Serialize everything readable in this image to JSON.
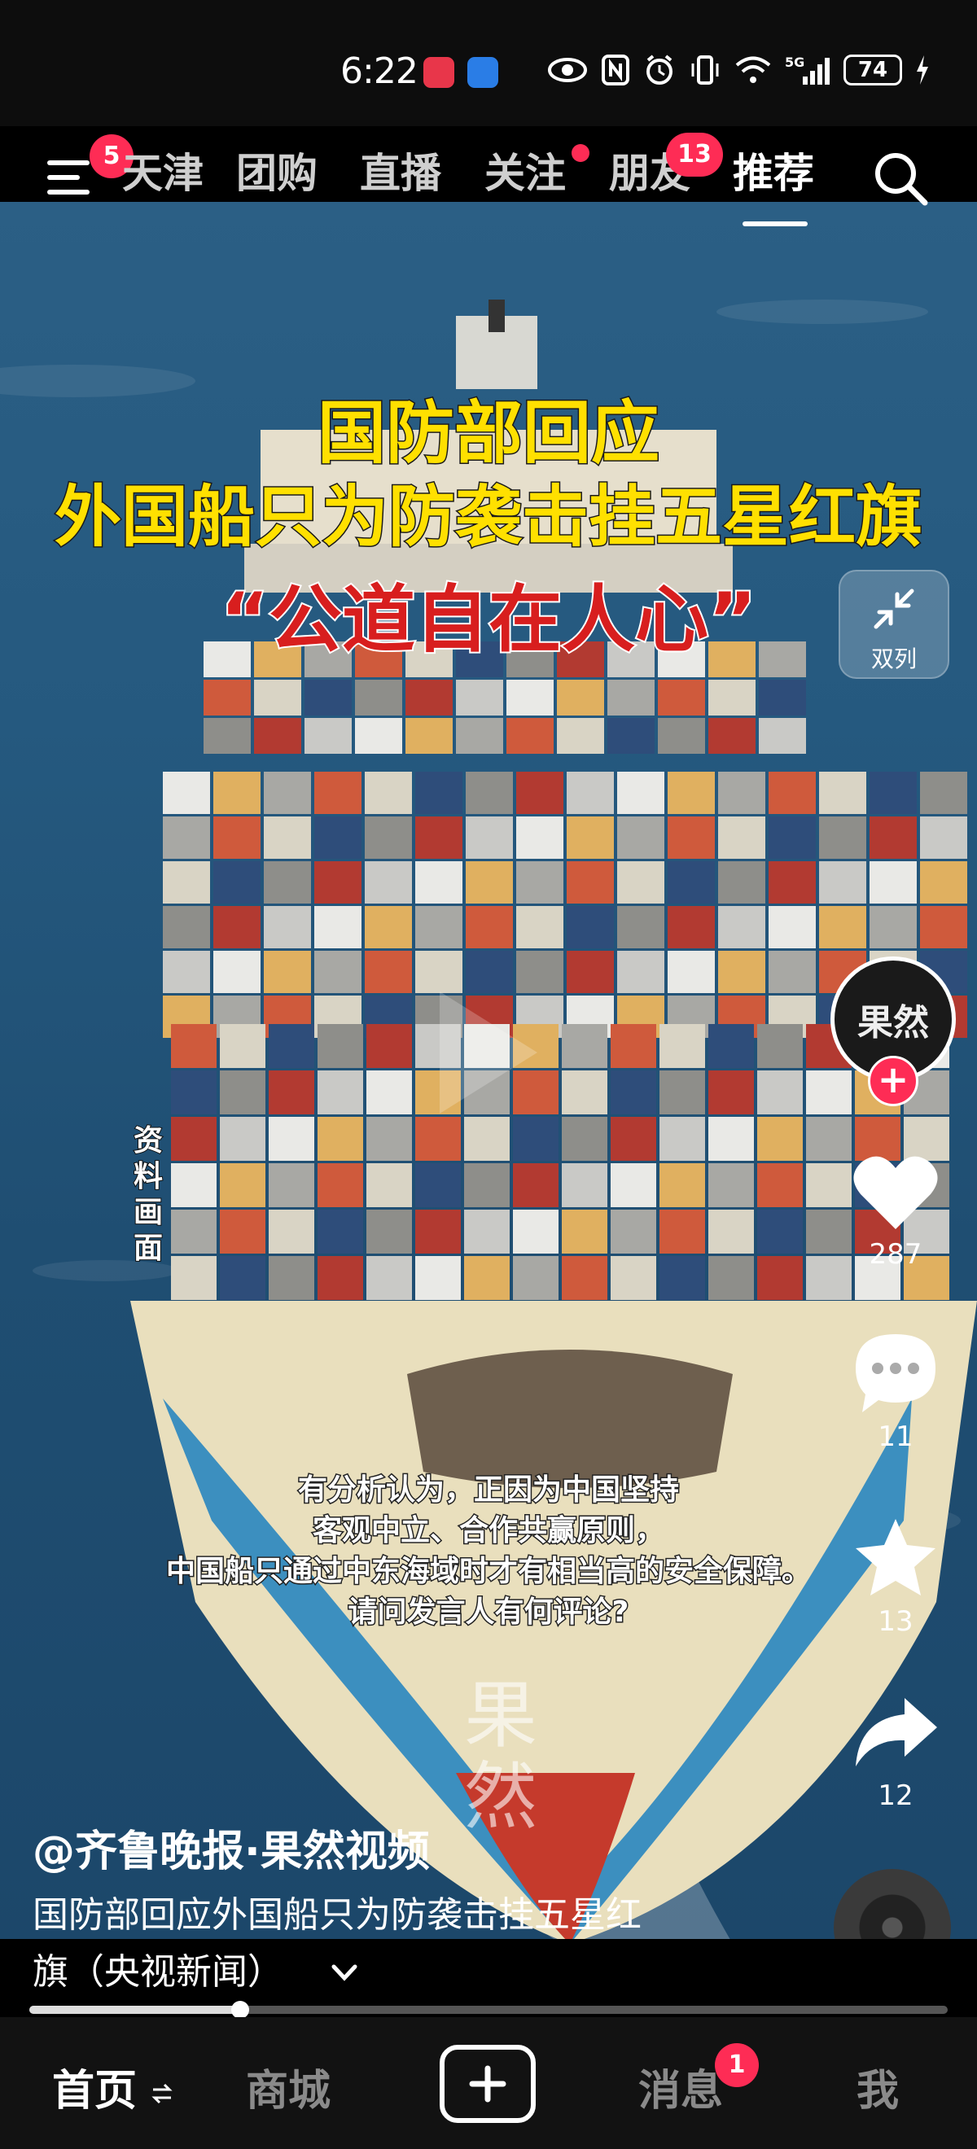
{
  "status_bar": {
    "time": "6:22",
    "battery": "74",
    "icons": [
      "eye-icon",
      "nfc-icon",
      "alarm-icon",
      "vibrate-icon",
      "wifi-icon",
      "5g-icon",
      "signal-icon",
      "battery-icon",
      "charging-icon"
    ]
  },
  "top_tabs": {
    "menu_badge": "5",
    "items": [
      {
        "label": "天津"
      },
      {
        "label": "团购"
      },
      {
        "label": "直播"
      },
      {
        "label": "关注"
      },
      {
        "label": "朋友",
        "badge": "13"
      },
      {
        "label": "推荐",
        "active": true
      }
    ]
  },
  "video": {
    "title_line1": "国防部回应",
    "title_line2": "外国船只为防袭击挂五星红旗",
    "title_line3": "“公道自在人心”",
    "side_label": "资料画面",
    "caption_lines": [
      "有分析认为，正因为中国坚持",
      "客观中立、合作共赢原则，",
      "中国船只通过中东海域时才有相当高的安全保障。",
      "请问发言人有何评论?"
    ],
    "watermark": "果然"
  },
  "actions": {
    "dual_column_label": "双列",
    "avatar_text": "果然",
    "likes": "287",
    "comments": "11",
    "favorites": "13",
    "shares": "12"
  },
  "post": {
    "author": "@齐鲁晚报·果然视频",
    "desc_line1": "国防部回应外国船只为防袭击挂五星红",
    "desc_line2": "旗（央视新闻）"
  },
  "progress": {
    "fraction": 0.23
  },
  "bottom_nav": {
    "home": "首页",
    "mall": "商城",
    "messages": "消息",
    "messages_badge": "1",
    "me": "我"
  },
  "colors": {
    "accent": "#fe2c55",
    "title_yellow": "#ffe000",
    "title_red": "#d81e1e"
  }
}
